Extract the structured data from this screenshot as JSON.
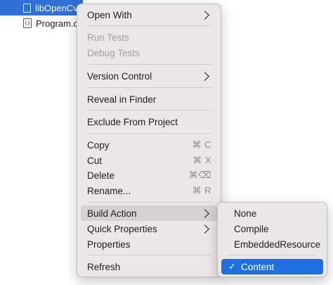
{
  "file_tree": {
    "selected_item": "libOpenCvSh",
    "item2": "Program.cs",
    "cs_icon_glyph": "{}"
  },
  "context_menu": {
    "open_with": "Open With",
    "run_tests": "Run Tests",
    "debug_tests": "Debug Tests",
    "version_control": "Version Control",
    "reveal_in_finder": "Reveal in Finder",
    "exclude_from_project": "Exclude From Project",
    "copy": "Copy",
    "copy_shortcut": "⌘ C",
    "cut": "Cut",
    "cut_shortcut": "⌘ X",
    "delete": "Delete",
    "delete_shortcut": "⌘⌫",
    "rename": "Rename...",
    "rename_shortcut": "⌘ R",
    "build_action": "Build Action",
    "quick_properties": "Quick Properties",
    "properties": "Properties",
    "refresh": "Refresh"
  },
  "build_action_submenu": {
    "none": "None",
    "compile": "Compile",
    "embedded_resource": "EmbeddedResource",
    "content": "Content",
    "checkmark": "✓",
    "selected": "Content"
  },
  "colors": {
    "accent": "#1f6fe0",
    "menu_bg": "#ede6e8",
    "disabled_text": "#a4a0a2"
  }
}
